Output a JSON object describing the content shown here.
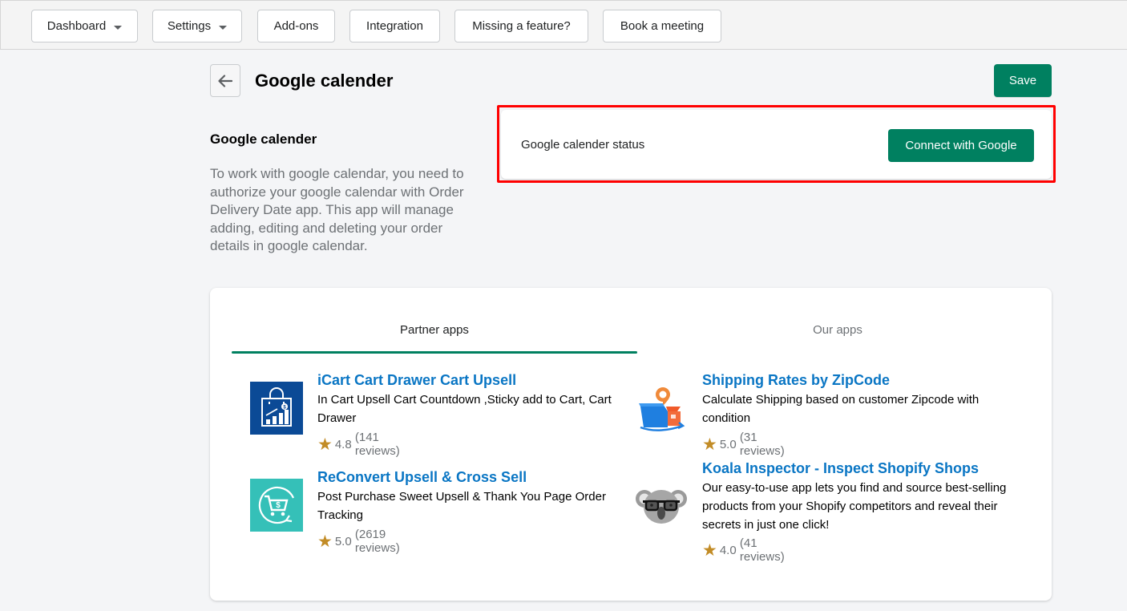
{
  "nav": {
    "items": [
      {
        "label": "Dashboard",
        "dropdown": true
      },
      {
        "label": "Settings",
        "dropdown": true
      },
      {
        "label": "Add-ons",
        "dropdown": false
      },
      {
        "label": "Integration",
        "dropdown": false
      },
      {
        "label": "Missing a feature?",
        "dropdown": false
      },
      {
        "label": "Book a meeting",
        "dropdown": false
      }
    ]
  },
  "header": {
    "title": "Google calender",
    "save_label": "Save",
    "back_icon": "arrow-left-icon"
  },
  "section": {
    "title": "Google calender",
    "description": "To work with google calendar, you need to authorize your google calendar with Order Delivery Date app. This app will manage adding, editing and deleting your order details in google calendar."
  },
  "status_card": {
    "label": "Google calender status",
    "connect_label": "Connect with Google",
    "highlight_color": "#ff0000"
  },
  "apps": {
    "tabs": [
      {
        "label": "Partner apps",
        "active": true
      },
      {
        "label": "Our apps",
        "active": false
      }
    ],
    "items": [
      {
        "name": "iCart Cart Drawer Cart Upsell",
        "description": "In Cart Upsell Cart Countdown ,Sticky add to Cart, Cart Drawer",
        "rating": "4.8",
        "reviews": "(141 reviews)",
        "icon": "shopping-bag-chart-icon"
      },
      {
        "name": "Shipping Rates by ZipCode",
        "description": "Calculate Shipping based on customer Zipcode with condition",
        "rating": "5.0",
        "reviews": "(31 reviews)",
        "icon": "shipping-box-pin-icon"
      },
      {
        "name": "ReConvert Upsell & Cross Sell",
        "description": "Post Purchase Sweet Upsell & Thank You Page Order Tracking",
        "rating": "5.0",
        "reviews": "(2619 reviews)",
        "icon": "cart-cycle-icon"
      },
      {
        "name": "Koala Inspector - Inspect Shopify Shops",
        "description": "Our easy-to-use app lets you find and source best-selling products from your Shopify competitors and reveal their secrets in just one click!",
        "rating": "4.0",
        "reviews": "(41 reviews)",
        "icon": "koala-glasses-icon"
      }
    ]
  },
  "colors": {
    "primary": "#008060",
    "link": "#0a76c4",
    "star": "#c28c26",
    "background": "#f4f5f7"
  }
}
